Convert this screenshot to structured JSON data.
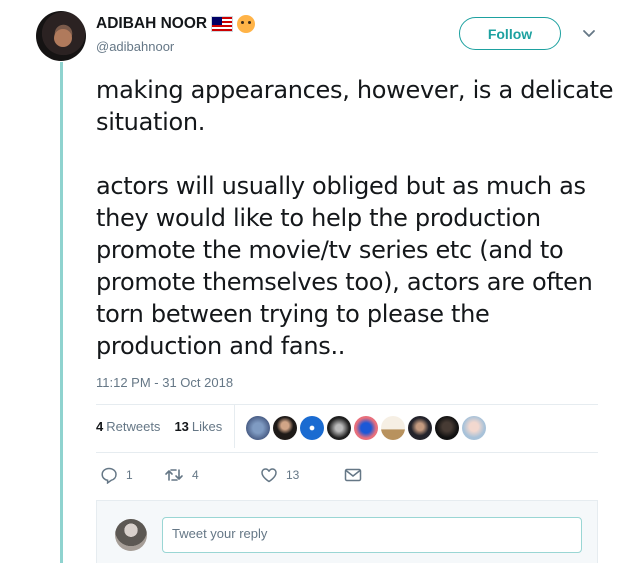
{
  "author": {
    "name": "ADIBAH NOOR",
    "handle": "@adibahnoor",
    "emoji": [
      "malaysia-flag-icon",
      "cat-face-icon"
    ]
  },
  "follow_button": "Follow",
  "tweet": {
    "paragraphs": [
      "making appearances, however, is a delicate situation.",
      "actors will usually obliged but as much as they would like to help the production promote the movie/tv series etc (and to promote themselves too), actors are often torn between trying to please the production and fans.."
    ],
    "timestamp": "11:12 PM - 31 Oct 2018"
  },
  "stats": {
    "retweets_count": "4",
    "retweets_label": "Retweets",
    "likes_count": "13",
    "likes_label": "Likes"
  },
  "actions": {
    "reply_count": "1",
    "retweet_count": "4",
    "like_count": "13"
  },
  "reply": {
    "placeholder": "Tweet your reply"
  },
  "colors": {
    "accent": "#1da1a0",
    "thread_line": "#8fd3cf",
    "muted_text": "#657786"
  }
}
